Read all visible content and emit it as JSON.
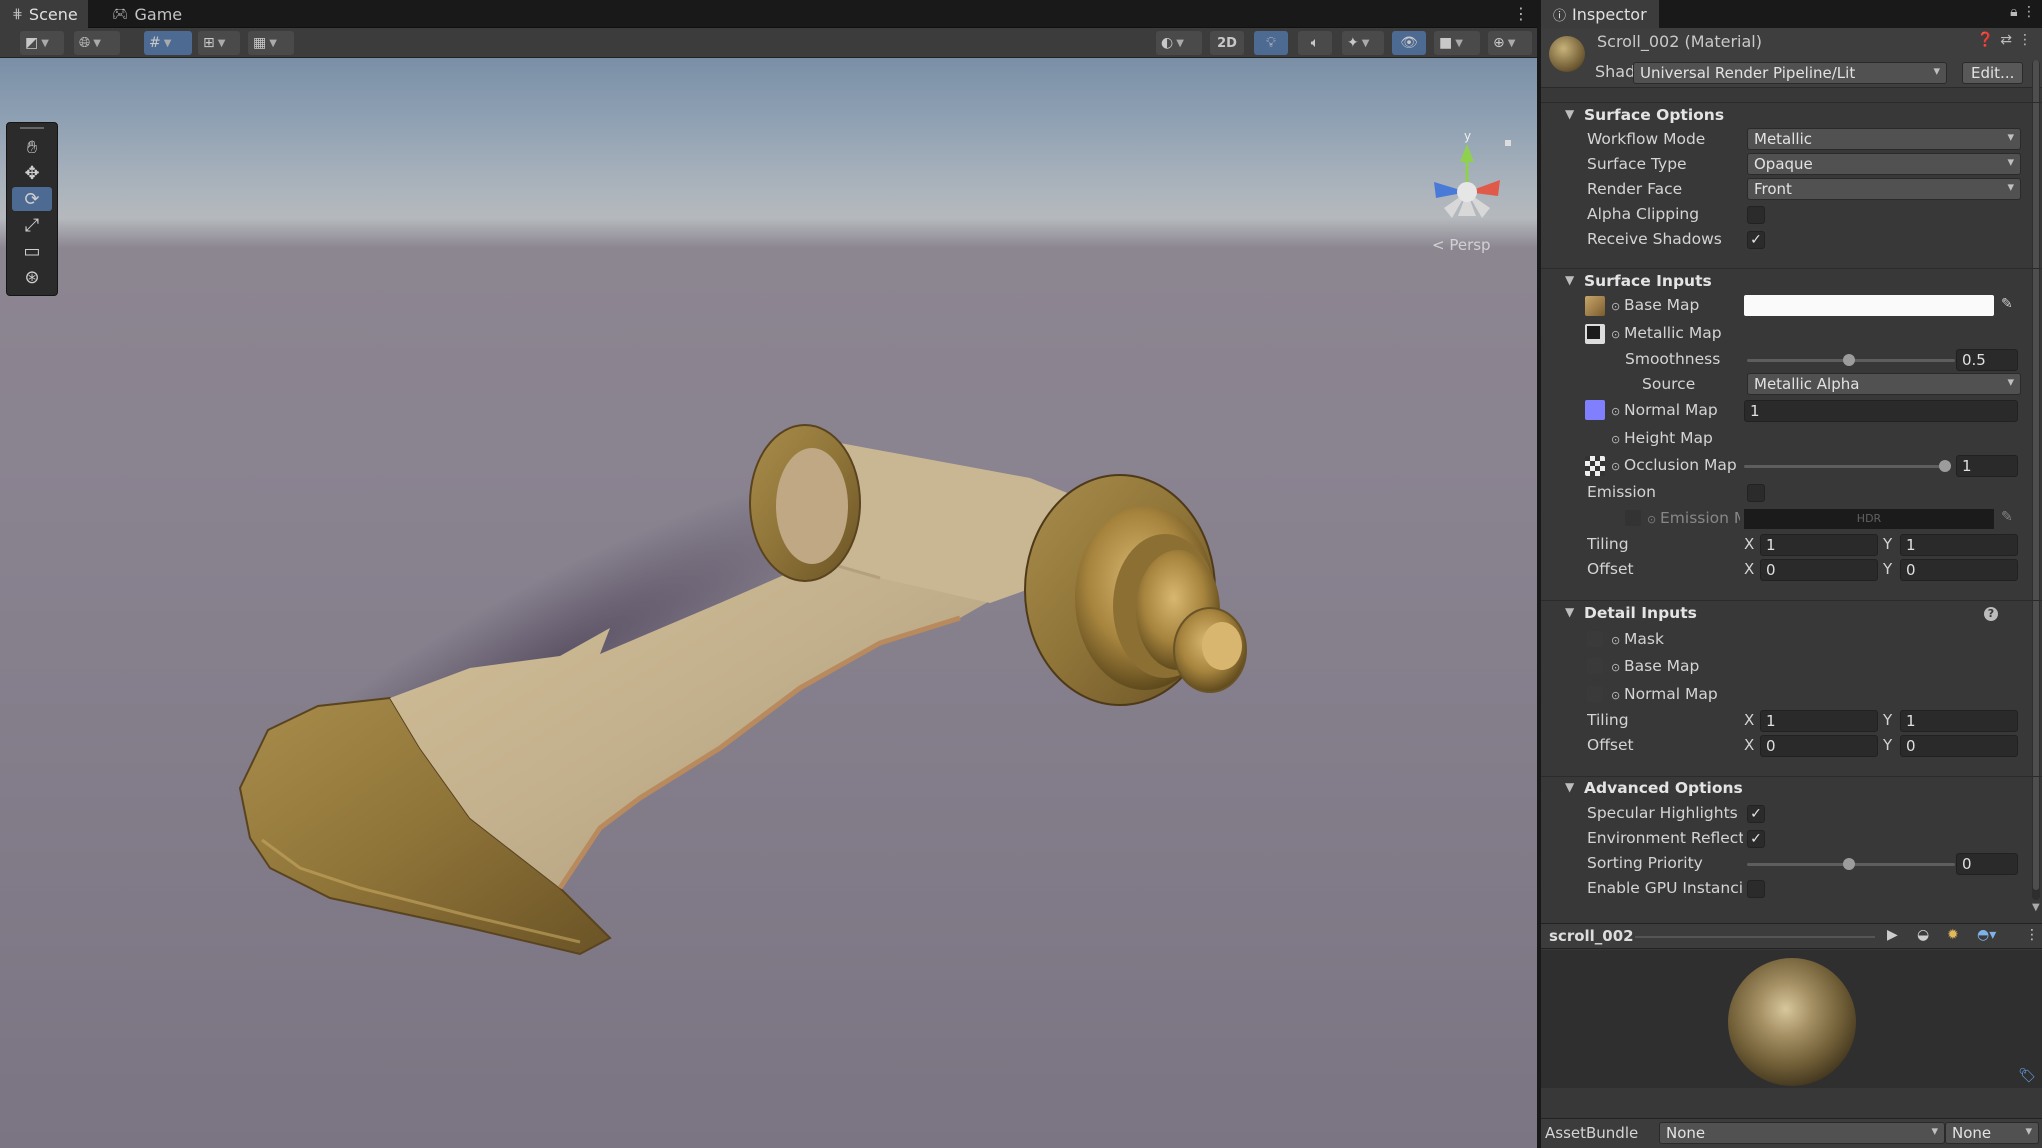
{
  "scene": {
    "tabs": [
      {
        "label": "Scene",
        "icon": "grid-icon"
      },
      {
        "label": "Game",
        "icon": "gamepad-icon"
      }
    ],
    "toolbar": {
      "btn_2d": "2D"
    },
    "view_label": "< Persp",
    "gizmo_axis": "y"
  },
  "inspector": {
    "tab_label": "Inspector",
    "material_name": "Scroll_002 (Material)",
    "shader_label": "Shader",
    "shader_value": "Universal Render Pipeline/Lit",
    "edit_label": "Edit...",
    "surface_options": {
      "title": "Surface Options",
      "workflow_mode": {
        "label": "Workflow Mode",
        "value": "Metallic"
      },
      "surface_type": {
        "label": "Surface Type",
        "value": "Opaque"
      },
      "render_face": {
        "label": "Render Face",
        "value": "Front"
      },
      "alpha_clipping": {
        "label": "Alpha Clipping",
        "checked": false
      },
      "receive_shadows": {
        "label": "Receive Shadows",
        "checked": true
      }
    },
    "surface_inputs": {
      "title": "Surface Inputs",
      "base_map": {
        "label": "Base Map"
      },
      "metallic_map": {
        "label": "Metallic Map"
      },
      "smoothness": {
        "label": "Smoothness",
        "value": "0.5",
        "fraction": 0.5
      },
      "source": {
        "label": "Source",
        "value": "Metallic Alpha"
      },
      "normal_map": {
        "label": "Normal Map",
        "value": "1"
      },
      "height_map": {
        "label": "Height Map"
      },
      "occlusion_map": {
        "label": "Occlusion Map",
        "value": "1",
        "fraction": 1.0
      },
      "emission": {
        "label": "Emission",
        "checked": false
      },
      "emission_map": {
        "label": "Emission M",
        "hdr": "HDR"
      },
      "tiling": {
        "label": "Tiling",
        "x_label": "X",
        "x": "1",
        "y_label": "Y",
        "y": "1"
      },
      "offset": {
        "label": "Offset",
        "x_label": "X",
        "x": "0",
        "y_label": "Y",
        "y": "0"
      }
    },
    "detail_inputs": {
      "title": "Detail Inputs",
      "mask": {
        "label": "Mask"
      },
      "base_map": {
        "label": "Base Map"
      },
      "normal_map": {
        "label": "Normal Map"
      },
      "tiling": {
        "label": "Tiling",
        "x_label": "X",
        "x": "1",
        "y_label": "Y",
        "y": "1"
      },
      "offset": {
        "label": "Offset",
        "x_label": "X",
        "x": "0",
        "y_label": "Y",
        "y": "0"
      }
    },
    "advanced_options": {
      "title": "Advanced Options",
      "specular_highlights": {
        "label": "Specular Highlights",
        "checked": true
      },
      "environment_reflections": {
        "label": "Environment Reflectio",
        "checked": true
      },
      "sorting_priority": {
        "label": "Sorting Priority",
        "value": "0",
        "fraction": 0.5
      },
      "gpu_instancing": {
        "label": "Enable GPU Instancin",
        "checked": false
      }
    },
    "preview": {
      "title": "scroll_002"
    },
    "asset_bundle": {
      "label": "AssetBundle",
      "name": "None",
      "variant": "None"
    }
  },
  "colors": {
    "accent": "#4d6a93",
    "normal_map_swatch": "#8080ff"
  }
}
